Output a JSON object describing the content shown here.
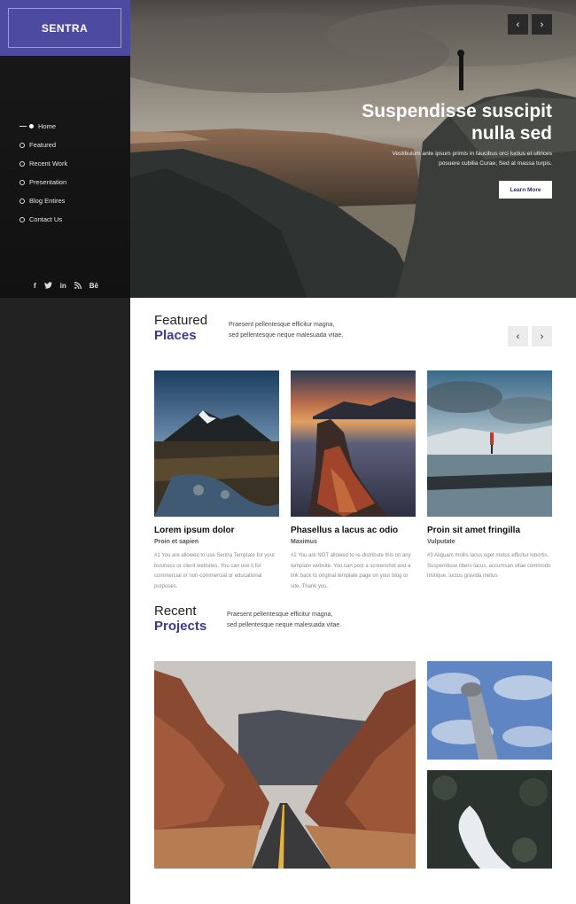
{
  "sidebar": {
    "brand": "SENTRA",
    "nav": [
      {
        "label": "Home",
        "active": true
      },
      {
        "label": "Featured",
        "active": false
      },
      {
        "label": "Recent Work",
        "active": false
      },
      {
        "label": "Presentation",
        "active": false
      },
      {
        "label": "Blog Entires",
        "active": false
      },
      {
        "label": "Contact Us",
        "active": false
      }
    ],
    "social": [
      "f",
      "t",
      "in",
      "rss",
      "Bē"
    ]
  },
  "hero": {
    "prev": "‹",
    "next": "›",
    "title_line1": "Suspendisse suscipit",
    "title_line2": "nulla sed",
    "text_line1": "Vestibulum ante ipsum primis in faucibus orci luctus et ultrices",
    "text_line2": "posuere cubilia Curae; Sed at massa turpis.",
    "button": "Learn More"
  },
  "featured": {
    "title1": "Featured",
    "title2": "Places",
    "desc_line1": "Praesent pellentesque efficitur magna,",
    "desc_line2": "sed pellentesque neque malesuada vitae.",
    "prev": "‹",
    "next": "›",
    "cards": [
      {
        "title": "Lorem ipsum dolor",
        "sub": "Proin et sapien",
        "text": "#1 You are allowed to use Sentra Template for your business or client websites. You can use it for commercial or non-commercial or educational purposes."
      },
      {
        "title": "Phasellus a lacus ac odio",
        "sub": "Maximus",
        "text": "#2 You are NOT allowed to re-distribute this on any template website. You can post a screenshot and a link back to original template page on your blog or site. Thank you."
      },
      {
        "title": "Proin sit amet fringilla",
        "sub": "Vulputate",
        "text": "#3 Aliquam mollis lacus eget metus efficitur lobortis. Suspendisse libero lacus, accumsan vitae commodo tristique, luctus gravida metus."
      }
    ]
  },
  "projects": {
    "title1": "Recent",
    "title2": "Projects",
    "desc_line1": "Praesent pellentesque efficitur magna,",
    "desc_line2": "sed pellentesque neque malesuada vitae."
  },
  "colors": {
    "brand": "#4d4ba0",
    "accent_text": "#3b3b8a",
    "sidebar": "#222222"
  }
}
